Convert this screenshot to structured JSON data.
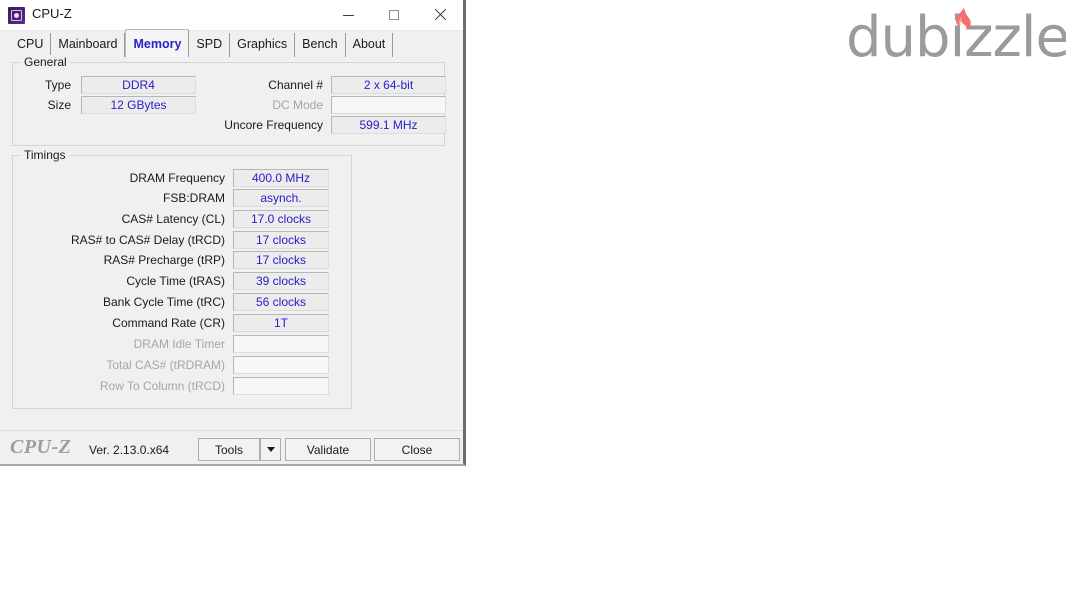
{
  "window": {
    "title": "CPU-Z",
    "icon": "cpu-chip-icon",
    "controls": {
      "minimize": "minimize-icon",
      "maximize": "maximize-icon",
      "close": "close-icon"
    }
  },
  "tabs": [
    {
      "label": "CPU",
      "selected": false
    },
    {
      "label": "Mainboard",
      "selected": false
    },
    {
      "label": "Memory",
      "selected": true
    },
    {
      "label": "SPD",
      "selected": false
    },
    {
      "label": "Graphics",
      "selected": false
    },
    {
      "label": "Bench",
      "selected": false
    },
    {
      "label": "About",
      "selected": false
    }
  ],
  "general": {
    "title": "General",
    "left_rows": [
      {
        "label": "Type",
        "value": "DDR4",
        "disabled": false
      },
      {
        "label": "Size",
        "value": "12 GBytes",
        "disabled": false
      }
    ],
    "right_rows": [
      {
        "label": "Channel #",
        "value": "2 x 64-bit",
        "disabled": false
      },
      {
        "label": "DC Mode",
        "value": "",
        "disabled": true
      },
      {
        "label": "Uncore Frequency",
        "value": "599.1 MHz",
        "disabled": false
      }
    ]
  },
  "timings": {
    "title": "Timings",
    "rows": [
      {
        "label": "DRAM Frequency",
        "value": "400.0 MHz",
        "disabled": false
      },
      {
        "label": "FSB:DRAM",
        "value": "asynch.",
        "disabled": false
      },
      {
        "label": "CAS# Latency (CL)",
        "value": "17.0 clocks",
        "disabled": false
      },
      {
        "label": "RAS# to CAS# Delay (tRCD)",
        "value": "17 clocks",
        "disabled": false
      },
      {
        "label": "RAS# Precharge (tRP)",
        "value": "17 clocks",
        "disabled": false
      },
      {
        "label": "Cycle Time (tRAS)",
        "value": "39 clocks",
        "disabled": false
      },
      {
        "label": "Bank Cycle Time (tRC)",
        "value": "56 clocks",
        "disabled": false
      },
      {
        "label": "Command Rate (CR)",
        "value": "1T",
        "disabled": false
      },
      {
        "label": "DRAM Idle Timer",
        "value": "",
        "disabled": true
      },
      {
        "label": "Total CAS# (tRDRAM)",
        "value": "",
        "disabled": true
      },
      {
        "label": "Row To Column (tRCD)",
        "value": "",
        "disabled": true
      }
    ]
  },
  "statusbar": {
    "logo": "CPU-Z",
    "version": "Ver. 2.13.0.x64",
    "tools_label": "Tools",
    "tools_dropdown_icon": "chevron-down-icon",
    "validate_label": "Validate",
    "close_label": "Close"
  },
  "watermark": {
    "text": "dubizzle",
    "flame_icon": "flame-icon",
    "text_color": "#9b9b9b",
    "flame_color": "#f26e6e"
  },
  "colors": {
    "value_text": "#2a20c8",
    "selected_tab_text": "#2a20c8",
    "disabled_label": "#a6a6a6",
    "window_bg": "#f0f0f0",
    "field_bg": "#ececec"
  }
}
